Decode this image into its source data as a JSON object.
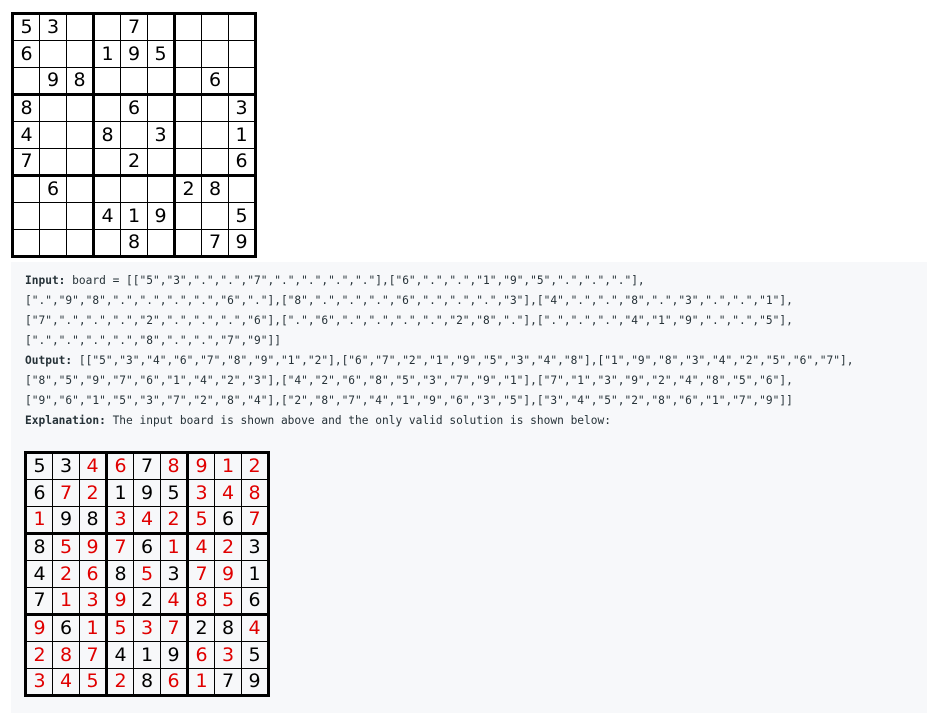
{
  "input_board": [
    [
      "5",
      "3",
      ".",
      ".",
      "7",
      ".",
      ".",
      ".",
      "."
    ],
    [
      "6",
      ".",
      ".",
      "1",
      "9",
      "5",
      ".",
      ".",
      "."
    ],
    [
      ".",
      "9",
      "8",
      ".",
      ".",
      ".",
      ".",
      "6",
      "."
    ],
    [
      "8",
      ".",
      ".",
      ".",
      "6",
      ".",
      ".",
      ".",
      "3"
    ],
    [
      "4",
      ".",
      ".",
      "8",
      ".",
      "3",
      ".",
      ".",
      "1"
    ],
    [
      "7",
      ".",
      ".",
      ".",
      "2",
      ".",
      ".",
      ".",
      "6"
    ],
    [
      ".",
      "6",
      ".",
      ".",
      ".",
      ".",
      "2",
      "8",
      "."
    ],
    [
      ".",
      ".",
      ".",
      "4",
      "1",
      "9",
      ".",
      ".",
      "5"
    ],
    [
      ".",
      ".",
      ".",
      ".",
      "8",
      ".",
      ".",
      "7",
      "9"
    ]
  ],
  "output_board": [
    [
      "5",
      "3",
      "4",
      "6",
      "7",
      "8",
      "9",
      "1",
      "2"
    ],
    [
      "6",
      "7",
      "2",
      "1",
      "9",
      "5",
      "3",
      "4",
      "8"
    ],
    [
      "1",
      "9",
      "8",
      "3",
      "4",
      "2",
      "5",
      "6",
      "7"
    ],
    [
      "8",
      "5",
      "9",
      "7",
      "6",
      "1",
      "4",
      "2",
      "3"
    ],
    [
      "4",
      "2",
      "6",
      "8",
      "5",
      "3",
      "7",
      "9",
      "1"
    ],
    [
      "7",
      "1",
      "3",
      "9",
      "2",
      "4",
      "8",
      "5",
      "6"
    ],
    [
      "9",
      "6",
      "1",
      "5",
      "3",
      "7",
      "2",
      "8",
      "4"
    ],
    [
      "2",
      "8",
      "7",
      "4",
      "1",
      "9",
      "6",
      "3",
      "5"
    ],
    [
      "3",
      "4",
      "5",
      "2",
      "8",
      "6",
      "1",
      "7",
      "9"
    ]
  ],
  "colors": {
    "given": "#000000",
    "filled": "#e00000",
    "example_bg": "#f7f8fa"
  },
  "example": {
    "input_label": "Input:",
    "input_lines": [
      " board = [[\"5\",\"3\",\".\",\".\",\"7\",\".\",\".\",\".\",\".\"],[\"6\",\".\",\".\",\"1\",\"9\",\"5\",\".\",\".\",\".\"],",
      "[\".\",\"9\",\"8\",\".\",\".\",\".\",\".\",\"6\",\".\"],[\"8\",\".\",\".\",\".\",\"6\",\".\",\".\",\".\",\"3\"],[\"4\",\".\",\".\",\"8\",\".\",\"3\",\".\",\".\",\"1\"],",
      "[\"7\",\".\",\".\",\".\",\"2\",\".\",\".\",\".\",\"6\"],[\".\",\"6\",\".\",\".\",\".\",\".\",\"2\",\"8\",\".\"],[\".\",\".\",\".\",\"4\",\"1\",\"9\",\".\",\".\",\"5\"],",
      "[\".\",\".\",\".\",\".\",\"8\",\".\",\".\",\"7\",\"9\"]]"
    ],
    "output_label": "Output:",
    "output_lines": [
      " [[\"5\",\"3\",\"4\",\"6\",\"7\",\"8\",\"9\",\"1\",\"2\"],[\"6\",\"7\",\"2\",\"1\",\"9\",\"5\",\"3\",\"4\",\"8\"],[\"1\",\"9\",\"8\",\"3\",\"4\",\"2\",\"5\",\"6\",\"7\"],",
      "[\"8\",\"5\",\"9\",\"7\",\"6\",\"1\",\"4\",\"2\",\"3\"],[\"4\",\"2\",\"6\",\"8\",\"5\",\"3\",\"7\",\"9\",\"1\"],[\"7\",\"1\",\"3\",\"9\",\"2\",\"4\",\"8\",\"5\",\"6\"],",
      "[\"9\",\"6\",\"1\",\"5\",\"3\",\"7\",\"2\",\"8\",\"4\"],[\"2\",\"8\",\"7\",\"4\",\"1\",\"9\",\"6\",\"3\",\"5\"],[\"3\",\"4\",\"5\",\"2\",\"8\",\"6\",\"1\",\"7\",\"9\"]]"
    ],
    "explanation_label": "Explanation:",
    "explanation_text": " The input board is shown above and the only valid solution is shown below:"
  }
}
